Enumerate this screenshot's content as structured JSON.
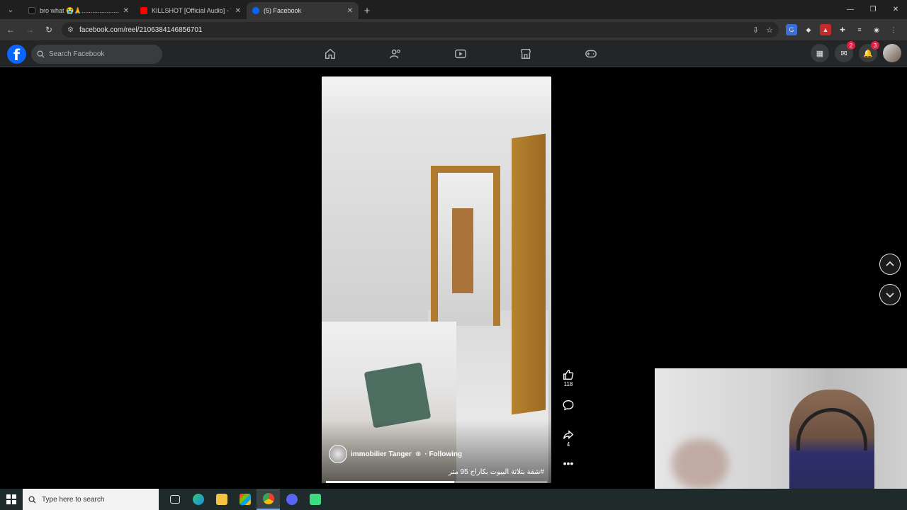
{
  "browser": {
    "tabs": [
      {
        "title": "bro what 😭🙏........................#fy",
        "favicon_color": "#111111",
        "active": false
      },
      {
        "title": "KILLSHOT [Official Audio] - You",
        "favicon_color": "#ff0000",
        "active": false
      },
      {
        "title": "(5) Facebook",
        "favicon_color": "#0866ff",
        "active": true
      }
    ],
    "new_tab_label": "+",
    "url": "facebook.com/reel/2106384146856701"
  },
  "facebook": {
    "search_placeholder": "Search Facebook",
    "logo_letter": "f",
    "messenger_badge": "2",
    "notifications_badge": "3"
  },
  "reel": {
    "owner_name": "immobilier Tanger",
    "following_label": "· Following",
    "caption": "#شقة بتلاثة البيوت بكاراج 95 متر",
    "progress": 0.58,
    "likes": "118",
    "shares": "4"
  },
  "taskbar": {
    "search_placeholder": "Type here to search"
  }
}
